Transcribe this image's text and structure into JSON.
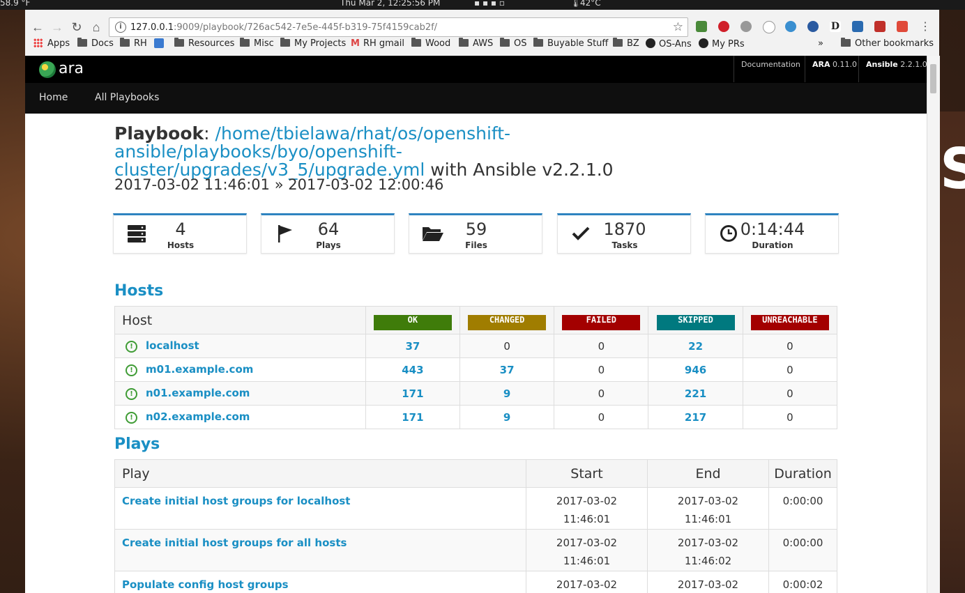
{
  "system_bar": {
    "temp_left": "58.9 °F",
    "clock": "Thu Mar  2, 12:25:56 PM",
    "cpu_temp": "42°C"
  },
  "browser": {
    "url_host": "127.0.0.1",
    "url_rest": ":9009/playbook/726ac542-7e5e-445f-b319-75f4159cab2f/",
    "bookmarks": [
      "Apps",
      "Docs",
      "RH",
      "Resources",
      "Misc",
      "My Projects",
      "RH gmail",
      "Wood",
      "AWS",
      "OS",
      "Buyable Stuff",
      "BZ",
      "OS-Ans",
      "My PRs"
    ],
    "overflow": "»",
    "other_bookmarks": "Other bookmarks"
  },
  "app": {
    "logo_text": "ara",
    "documentation": "Documentation",
    "ara_label": "ARA",
    "ara_version": "0.11.0",
    "ansible_label": "Ansible",
    "ansible_version": "2.2.1.0",
    "nav_home": "Home",
    "nav_all_playbooks": "All Playbooks"
  },
  "playbook": {
    "label": "Playbook",
    "path_line1": "/home/tbielawa/rhat/os/openshift-ansible/playbooks/byo/openshift-",
    "path_line2": "cluster/upgrades/v3_5/upgrade.yml",
    "with_ansible": " with Ansible v2.2.1.0",
    "start": "2017-03-02 11:46:01",
    "separator": "»",
    "end": "2017-03-02 12:00:46"
  },
  "stats": [
    {
      "icon": "server-icon",
      "value": "4",
      "label": "Hosts"
    },
    {
      "icon": "flag-icon",
      "value": "64",
      "label": "Plays"
    },
    {
      "icon": "folder-open-icon",
      "value": "59",
      "label": "Files"
    },
    {
      "icon": "check-icon",
      "value": "1870",
      "label": "Tasks"
    },
    {
      "icon": "clock-icon",
      "value": "0:14:44",
      "label": "Duration"
    }
  ],
  "hosts": {
    "title": "Hosts",
    "columns": [
      "Host",
      "OK",
      "CHANGED",
      "FAILED",
      "SKIPPED",
      "UNREACHABLE"
    ],
    "colors": {
      "ok": "#3f7c0a",
      "changed": "#a07d00",
      "failed": "#a30000",
      "skipped": "#00797f",
      "unreachable": "#a30000"
    },
    "rows": [
      {
        "name": "localhost",
        "ok": "37",
        "changed": "0",
        "failed": "0",
        "skipped": "22",
        "unreachable": "0"
      },
      {
        "name": "m01.example.com",
        "ok": "443",
        "changed": "37",
        "failed": "0",
        "skipped": "946",
        "unreachable": "0"
      },
      {
        "name": "n01.example.com",
        "ok": "171",
        "changed": "9",
        "failed": "0",
        "skipped": "221",
        "unreachable": "0"
      },
      {
        "name": "n02.example.com",
        "ok": "171",
        "changed": "9",
        "failed": "0",
        "skipped": "217",
        "unreachable": "0"
      }
    ]
  },
  "plays": {
    "title": "Plays",
    "columns": [
      "Play",
      "Start",
      "End",
      "Duration"
    ],
    "rows": [
      {
        "name": "Create initial host groups for localhost",
        "start_date": "2017-03-02",
        "start_time": "11:46:01",
        "end_date": "2017-03-02",
        "end_time": "11:46:01",
        "duration": "0:00:00"
      },
      {
        "name": "Create initial host groups for all hosts",
        "start_date": "2017-03-02",
        "start_time": "11:46:01",
        "end_date": "2017-03-02",
        "end_time": "11:46:02",
        "duration": "0:00:00"
      },
      {
        "name": "Populate config host groups",
        "start_date": "2017-03-02",
        "start_time": "",
        "end_date": "2017-03-02",
        "end_time": "",
        "duration": "0:00:02"
      }
    ]
  }
}
